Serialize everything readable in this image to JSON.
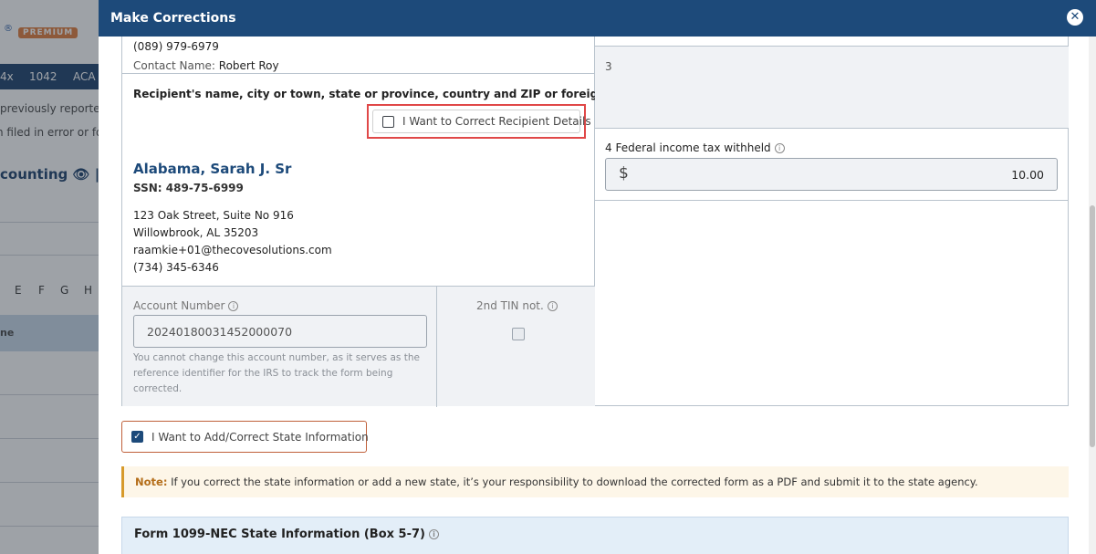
{
  "background": {
    "premium_badge": "PREMIUM",
    "registered_mark": "®",
    "nav_tabs": [
      "4x",
      "1042",
      "ACA"
    ],
    "text_line1": "previously reported",
    "text_line2": "n filed in error or for",
    "heading": "counting",
    "column_letters": [
      "E",
      "F",
      "G",
      "H"
    ],
    "table_header": "ne"
  },
  "modal": {
    "title": "Make Corrections",
    "close_icon": "✕"
  },
  "payer": {
    "phone": "(089) 979-6979",
    "contact_label": "Contact Name:",
    "contact_name": "Robert Roy"
  },
  "recipient": {
    "section_label": "Recipient's name, city or town, state or province, country and ZIP or foreign postal code",
    "correct_checkbox_label": "I Want to Correct Recipient Details",
    "name": "Alabama, Sarah J. Sr",
    "ssn": "SSN: 489-75-6999",
    "address1": "123 Oak Street, Suite No 916",
    "address2": "Willowbrook, AL 35203",
    "email": "raamkie+01@thecovesolutions.com",
    "phone": "(734) 345-6346"
  },
  "account": {
    "label": "Account Number",
    "value": "20240180031452000070",
    "help": "You cannot change this account number, as it serves as the reference identifier for the IRS to track the form being corrected.",
    "tin_label": "2nd TIN not."
  },
  "boxes": {
    "box3_number": "3",
    "box4_label": "4  Federal income tax withheld",
    "box4_currency": "$",
    "box4_value": "10.00"
  },
  "state": {
    "toggle_label": "I Want to Add/Correct State Information",
    "note_prefix": "Note:",
    "note_text": " If you correct the state information or add a new state, it’s your responsibility to download the corrected form as a PDF and submit it to the state agency.",
    "section_title": "Form 1099-NEC  State Information  (Box 5-7)"
  }
}
